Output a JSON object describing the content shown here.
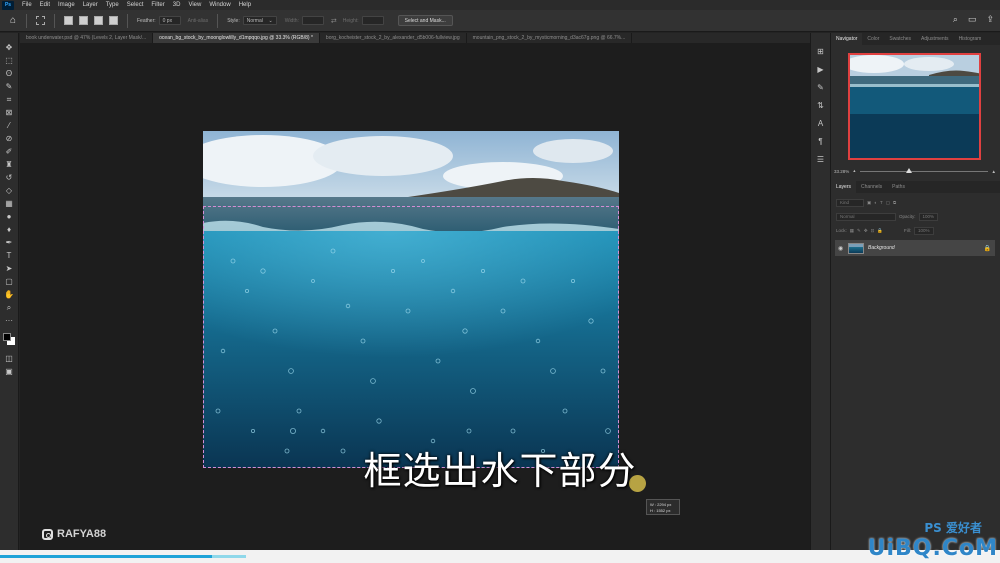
{
  "menubar": {
    "app_icon": "Ps",
    "items": [
      "File",
      "Edit",
      "Image",
      "Layer",
      "Type",
      "Select",
      "Filter",
      "3D",
      "View",
      "Window",
      "Help"
    ]
  },
  "options": {
    "feather_label": "Feather:",
    "feather_value": "0 px",
    "anti_alias_label": "Anti-alias",
    "style_label": "Style:",
    "style_value": "Normal",
    "width_label": "Width:",
    "height_label": "Height:",
    "select_mask_label": "Select and Mask..."
  },
  "tabs": [
    "book underwater.psd @ 47% (Levels 2, Layer Mask/...",
    "ocean_bg_stock_by_moonglowlilly_d1mpqqo.jpg @ 33.3% (RGB/8) *",
    "borg_kocheister_stock_2_by_alexander_d5b006-fullview.jpg",
    "mountain_png_stock_2_by_mysticmorning_d3ac67g.png @ 66.7%..."
  ],
  "canvas": {
    "dims_w": "W : 2294 px",
    "dims_h": "H : 1552 px",
    "subtitle": "框选出水下部分",
    "instagram_handle": "RAFYA88"
  },
  "navigator": {
    "tabs": [
      "Navigator",
      "Color",
      "Swatches",
      "Adjustments",
      "Histogram"
    ],
    "zoom": "33.28%"
  },
  "layers": {
    "tabs": [
      "Layers",
      "Channels",
      "Paths"
    ],
    "kind": "Kind",
    "blend": "Normal",
    "opacity_label": "Opacity:",
    "opacity_value": "100%",
    "lock_label": "Lock:",
    "fill_label": "Fill:",
    "fill_value": "100%",
    "layer_name": "Background"
  },
  "watermark": {
    "site": "UiBQ.CoM",
    "ps_logo": "PS 爱好者"
  },
  "video": {
    "progress_fraction": 0.212
  }
}
